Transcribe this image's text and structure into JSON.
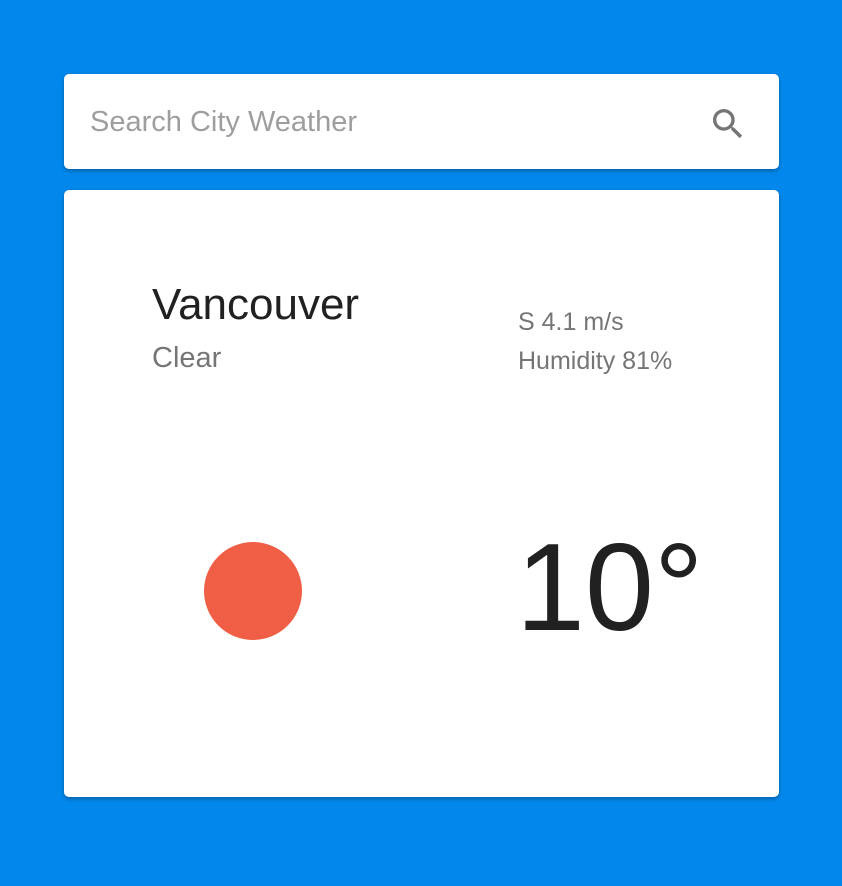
{
  "search": {
    "placeholder": "Search City Weather",
    "value": ""
  },
  "weather": {
    "city": "Vancouver",
    "condition": "Clear",
    "wind": "S 4.1 m/s",
    "humidity": "Humidity 81%",
    "temperature": "10°",
    "icon": "sun-icon"
  },
  "colors": {
    "background": "#0288ec",
    "sun": "#f05f45"
  }
}
